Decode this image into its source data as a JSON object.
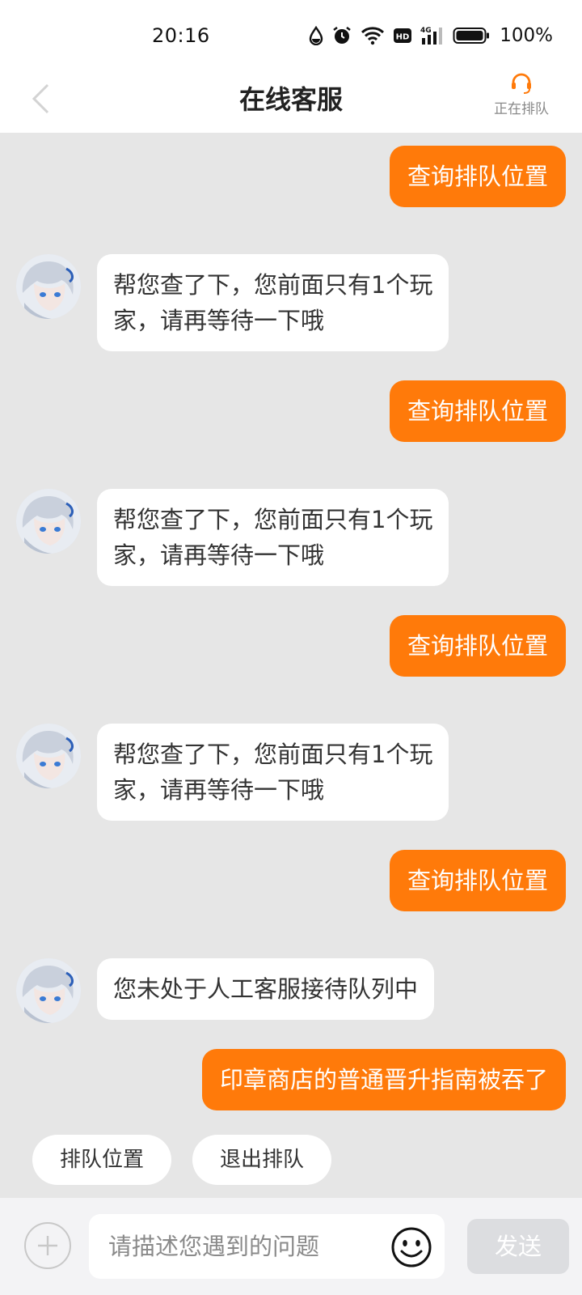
{
  "status_bar": {
    "time": "20:16",
    "battery_percent": "100%",
    "icons": [
      "drop-icon",
      "alarm-icon",
      "wifi-icon",
      "hd-icon",
      "signal-4g-icon",
      "battery-icon"
    ]
  },
  "nav": {
    "title": "在线客服",
    "back_icon": "chevron-left-icon",
    "queue_icon": "headset-icon",
    "queue_label": "正在排队"
  },
  "messages": [
    {
      "from": "user",
      "text": "查询排队位置"
    },
    {
      "from": "agent",
      "line1": "帮您查了下，您前面只有1个玩",
      "line2": "家，请再等待一下哦"
    },
    {
      "from": "user",
      "text": "查询排队位置"
    },
    {
      "from": "agent",
      "line1": "帮您查了下，您前面只有1个玩",
      "line2": "家，请再等待一下哦"
    },
    {
      "from": "user",
      "text": "查询排队位置"
    },
    {
      "from": "agent",
      "line1": "帮您查了下，您前面只有1个玩",
      "line2": "家，请再等待一下哦"
    },
    {
      "from": "user",
      "text": "查询排队位置"
    },
    {
      "from": "agent",
      "text": "您未处于人工客服接待队列中"
    },
    {
      "from": "user",
      "text": "印章商店的普通晋升指南被吞了"
    }
  ],
  "quick_actions": [
    "排队位置",
    "退出排队"
  ],
  "input": {
    "placeholder": "请描述您遇到的问题",
    "value": "",
    "send_label": "发送",
    "plus_icon": "plus-icon",
    "emoji_icon": "smiley-icon"
  },
  "colors": {
    "accent": "#ff7a0a",
    "chat_bg": "#e6e6e6",
    "send_disabled": "#dcdde0"
  }
}
